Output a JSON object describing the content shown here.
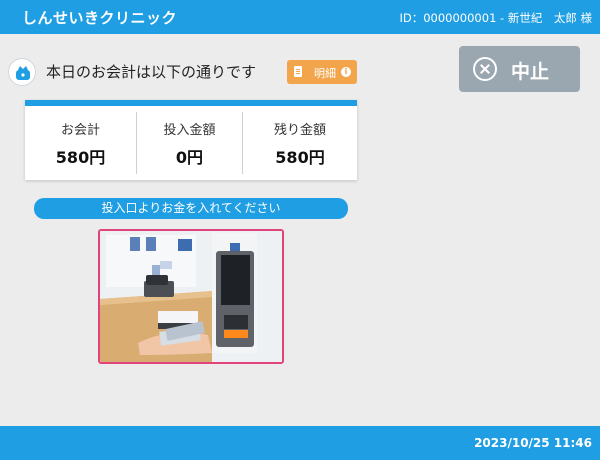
{
  "header": {
    "app_title": "しんせいきクリニック",
    "patient_info": "ID：0000000001 - 新世紀　太郎 様"
  },
  "message": {
    "main_text": "本日のお会計は以下の通りです",
    "icon": "wallet-icon"
  },
  "detail_button": {
    "label": "明細",
    "icons": [
      "document-icon",
      "info-icon"
    ]
  },
  "cancel_button": {
    "label": "中止",
    "icon": "x-circle-icon"
  },
  "amounts": [
    {
      "label": "お会計",
      "value": "580円"
    },
    {
      "label": "投入金額",
      "value": "0円"
    },
    {
      "label": "残り金額",
      "value": "580円"
    }
  ],
  "instruction": "投入口よりお金を入れてください",
  "footer": {
    "datetime": "2023/10/25 11:46"
  },
  "colors": {
    "primary": "#1f9ee3",
    "accent_orange": "#f2a54a",
    "cancel_gray": "#9aa7b1",
    "image_border": "#e0447a",
    "background": "#ececec"
  }
}
